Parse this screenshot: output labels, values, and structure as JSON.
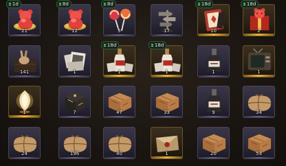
{
  "colors": {
    "rare_slot": "#2a2736",
    "legendary_slot": "#2c2216",
    "legendary_accent": "#f0b43a",
    "timer_bg": "#17261b",
    "timer_icon": "#5fc06a"
  },
  "items": [
    {
      "name": "red-gummy-bear-tray",
      "icon": "gummy-bear-icon",
      "rarity": "purple",
      "quantity": "21",
      "timer": "1d"
    },
    {
      "name": "red-gummy-bear-tray",
      "icon": "gummy-bear-icon",
      "rarity": "purple",
      "quantity": "12",
      "timer": "8d"
    },
    {
      "name": "lollipops",
      "icon": "lollipop-icon",
      "rarity": "purple",
      "quantity": "5",
      "timer": "8d"
    },
    {
      "name": "signpost",
      "icon": "signpost-icon",
      "rarity": "purple",
      "quantity": "17",
      "timer": ""
    },
    {
      "name": "playing-cards-box",
      "icon": "card-box-icon",
      "rarity": "gold",
      "quantity": "10",
      "timer": "18d"
    },
    {
      "name": "red-gummy-bear-gift",
      "icon": "gift-bear-icon",
      "rarity": "gold",
      "quantity": "2",
      "timer": "18d"
    },
    {
      "name": "rabbit-in-crate",
      "icon": "rabbit-crate-icon",
      "rarity": "purple",
      "quantity": "141",
      "timer": ""
    },
    {
      "name": "photo-stack",
      "icon": "photo-stack-icon",
      "rarity": "purple",
      "quantity": "1",
      "timer": ""
    },
    {
      "name": "bottle-with-photo",
      "icon": "bottle-photo-icon",
      "rarity": "gold",
      "quantity": "1",
      "timer": "18d"
    },
    {
      "name": "bottle-with-photo",
      "icon": "bottle-photo-icon",
      "rarity": "gold",
      "quantity": "1",
      "timer": "18d"
    },
    {
      "name": "dark-bottle",
      "icon": "bottle-icon",
      "rarity": "purple",
      "quantity": "1",
      "timer": ""
    },
    {
      "name": "retro-television",
      "icon": "television-icon",
      "rarity": "gold",
      "quantity": "1",
      "timer": ""
    },
    {
      "name": "glowing-orb",
      "icon": "glowing-orb-icon",
      "rarity": "gold",
      "quantity": "1",
      "timer": ""
    },
    {
      "name": "ornate-chest",
      "icon": "ornate-chest-icon",
      "rarity": "purple",
      "quantity": "7",
      "timer": ""
    },
    {
      "name": "wooden-crate",
      "icon": "wooden-crate-icon",
      "rarity": "purple",
      "quantity": "47",
      "timer": ""
    },
    {
      "name": "wooden-crate",
      "icon": "wooden-crate-icon",
      "rarity": "purple",
      "quantity": "33",
      "timer": ""
    },
    {
      "name": "dark-bottle",
      "icon": "bottle-icon",
      "rarity": "purple",
      "quantity": "9",
      "timer": ""
    },
    {
      "name": "burlap-parcel",
      "icon": "parcel-icon",
      "rarity": "purple",
      "quantity": "34",
      "timer": ""
    },
    {
      "name": "burlap-parcel",
      "icon": "parcel-icon",
      "rarity": "purple",
      "quantity": "24",
      "timer": ""
    },
    {
      "name": "burlap-parcel",
      "icon": "parcel-icon",
      "rarity": "purple",
      "quantity": "196",
      "timer": ""
    },
    {
      "name": "burlap-parcel",
      "icon": "parcel-icon",
      "rarity": "purple",
      "quantity": "40",
      "timer": ""
    },
    {
      "name": "envelope",
      "icon": "envelope-icon",
      "rarity": "gold",
      "quantity": "1",
      "timer": ""
    },
    {
      "name": "wooden-crate",
      "icon": "wooden-crate-icon",
      "rarity": "purple",
      "quantity": "20",
      "timer": ""
    },
    {
      "name": "wooden-crate",
      "icon": "wooden-crate-icon",
      "rarity": "purple",
      "quantity": "53",
      "timer": ""
    }
  ]
}
